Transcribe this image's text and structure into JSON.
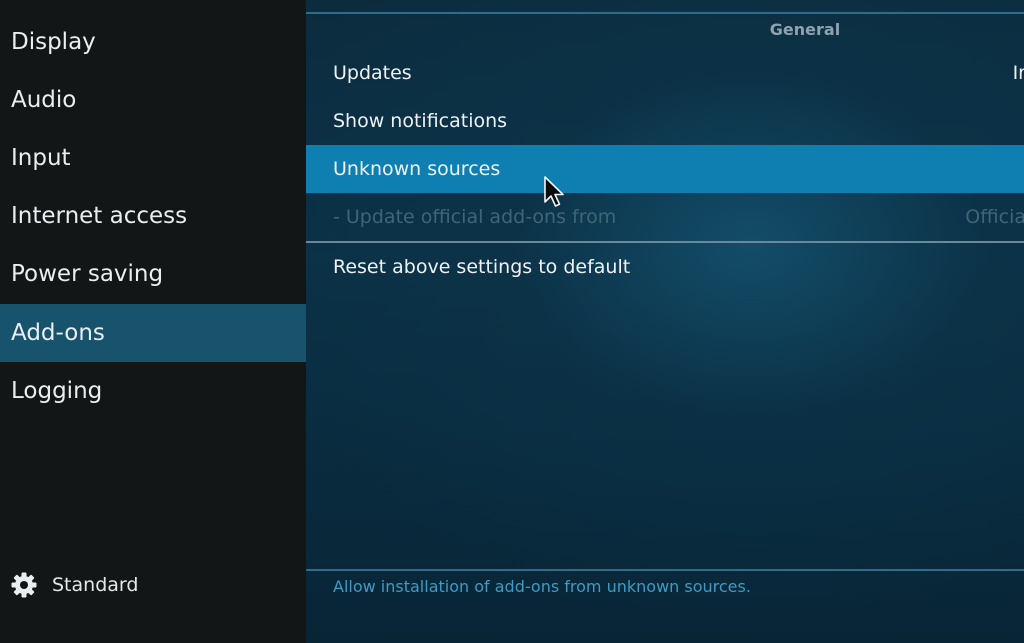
{
  "sidebar": {
    "categories": [
      {
        "label": "Display"
      },
      {
        "label": "Audio"
      },
      {
        "label": "Input"
      },
      {
        "label": "Internet access"
      },
      {
        "label": "Power saving"
      },
      {
        "label": "Add-ons"
      },
      {
        "label": "Logging"
      }
    ],
    "active_category": "Add-ons",
    "settings_level": {
      "label": "Standard",
      "icon": "gear-icon"
    }
  },
  "main": {
    "section_title": "General",
    "settings": [
      {
        "label": "Updates",
        "value": "Ir"
      },
      {
        "label": "Show notifications",
        "value": ""
      },
      {
        "label": "Unknown sources",
        "value": ""
      },
      {
        "label": "- Update official add-ons from",
        "value": "Officia"
      }
    ],
    "focused_setting": "Unknown sources",
    "disabled_setting": "- Update official add-ons from",
    "reset_label": "Reset above settings to default",
    "help_text": "Allow installation of add-ons from unknown sources."
  },
  "colors": {
    "sidebar_bg": "#121617",
    "active_category_bg": "#17536d",
    "focused_row_bg": "#0e7fb0",
    "help_text": "#3f9ac4"
  }
}
